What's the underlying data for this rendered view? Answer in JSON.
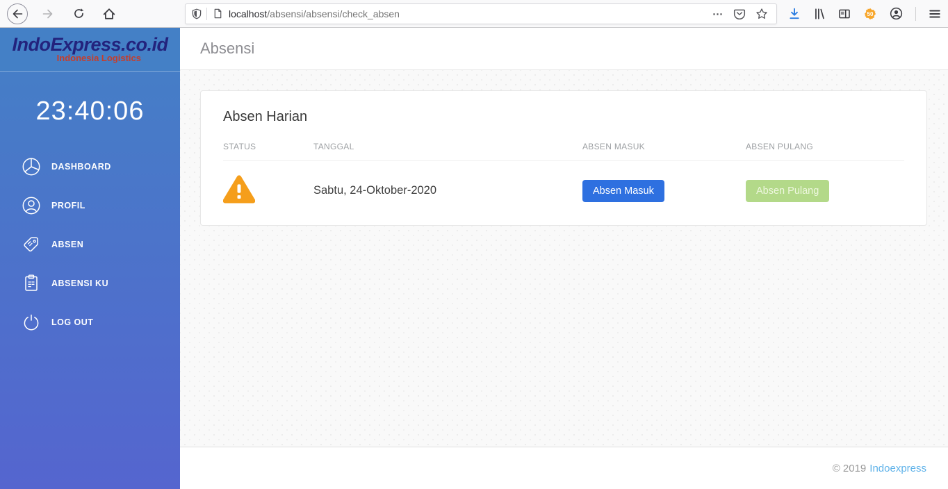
{
  "browser": {
    "url_host": "localhost",
    "url_path": "/absensi/absensi/check_absen",
    "page_actions_glyph": "⋯",
    "extension_badge": "50"
  },
  "sidebar": {
    "logo_title": "IndoExpress.co.id",
    "logo_subtitle": "Indonesia Logistics",
    "clock": "23:40:06",
    "items": [
      {
        "label": "DASHBOARD",
        "icon": "pie-chart-icon"
      },
      {
        "label": "PROFIL",
        "icon": "user-icon"
      },
      {
        "label": "ABSEN",
        "icon": "tag-icon"
      },
      {
        "label": "ABSENSI KU",
        "icon": "clipboard-icon"
      },
      {
        "label": "LOG OUT",
        "icon": "power-icon"
      }
    ]
  },
  "header": {
    "title": "Absensi"
  },
  "card": {
    "title": "Absen Harian",
    "table": {
      "columns": [
        "STATUS",
        "TANGGAL",
        "ABSEN MASUK",
        "ABSEN PULANG"
      ],
      "row": {
        "status_icon": "warning-icon",
        "tanggal": "Sabtu, 24-Oktober-2020",
        "absen_masuk_label": "Absen Masuk",
        "absen_pulang_label": "Absen Pulang"
      }
    }
  },
  "footer": {
    "copyright": "© 2019",
    "link_label": "Indoexpress"
  },
  "colors": {
    "sidebar_top": "#4480c6",
    "sidebar_bottom": "#5565cf",
    "primary_button": "#2e70e0",
    "success_button": "#b3d989",
    "warning": "#F59E1B",
    "link": "#5fb2e9",
    "logo_title": "#23237d",
    "logo_subtitle": "#c63d2a"
  }
}
